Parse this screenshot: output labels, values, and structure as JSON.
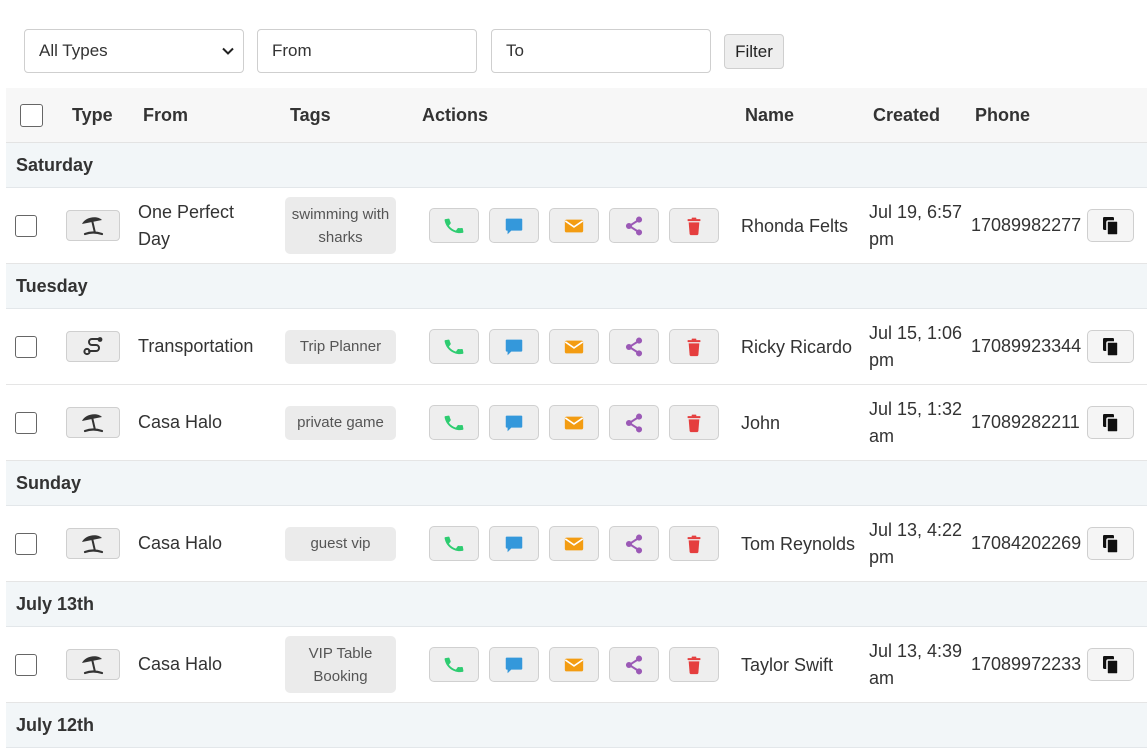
{
  "filter": {
    "type_selected": "All Types",
    "from_placeholder": "From",
    "to_placeholder": "To",
    "filter_label": "Filter"
  },
  "columns": {
    "type": "Type",
    "from": "From",
    "tags": "Tags",
    "actions": "Actions",
    "name": "Name",
    "created": "Created",
    "phone": "Phone"
  },
  "icons": {
    "call": "phone-icon",
    "message": "chat-icon",
    "email": "envelope-icon",
    "share": "share-icon",
    "delete": "trash-icon",
    "copy": "copy-icon"
  },
  "colors": {
    "call": "#2ecc71",
    "message": "#3498db",
    "email": "#f39c12",
    "share": "#9b59b6",
    "delete": "#e53e3e"
  },
  "groups": [
    {
      "label": "Saturday",
      "rows": [
        {
          "type_icon": "beach-umbrella-icon",
          "from": "One Perfect Day",
          "tag": "swimming with sharks",
          "name": "Rhonda Felts",
          "created": "Jul 19, 6:57 pm",
          "phone": "17089982277"
        }
      ]
    },
    {
      "label": "Tuesday",
      "rows": [
        {
          "type_icon": "route-icon",
          "from": "Transportation",
          "tag": "Trip Planner",
          "name": "Ricky Ricardo",
          "created": "Jul 15, 1:06 pm",
          "phone": "17089923344"
        },
        {
          "type_icon": "beach-umbrella-icon",
          "from": "Casa Halo",
          "tag": "private game",
          "name": "John",
          "created": "Jul 15, 1:32 am",
          "phone": "17089282211"
        }
      ]
    },
    {
      "label": "Sunday",
      "rows": [
        {
          "type_icon": "beach-umbrella-icon",
          "from": "Casa Halo",
          "tag": "guest vip",
          "name": "Tom Reynolds",
          "created": "Jul 13, 4:22 pm",
          "phone": "17084202269"
        }
      ]
    },
    {
      "label": "July 13th",
      "rows": [
        {
          "type_icon": "beach-umbrella-icon",
          "from": "Casa Halo",
          "tag": "VIP Table Booking",
          "name": "Taylor Swift",
          "created": "Jul 13, 4:39 am",
          "phone": "17089972233"
        }
      ]
    },
    {
      "label": "July 12th",
      "rows": []
    }
  ]
}
